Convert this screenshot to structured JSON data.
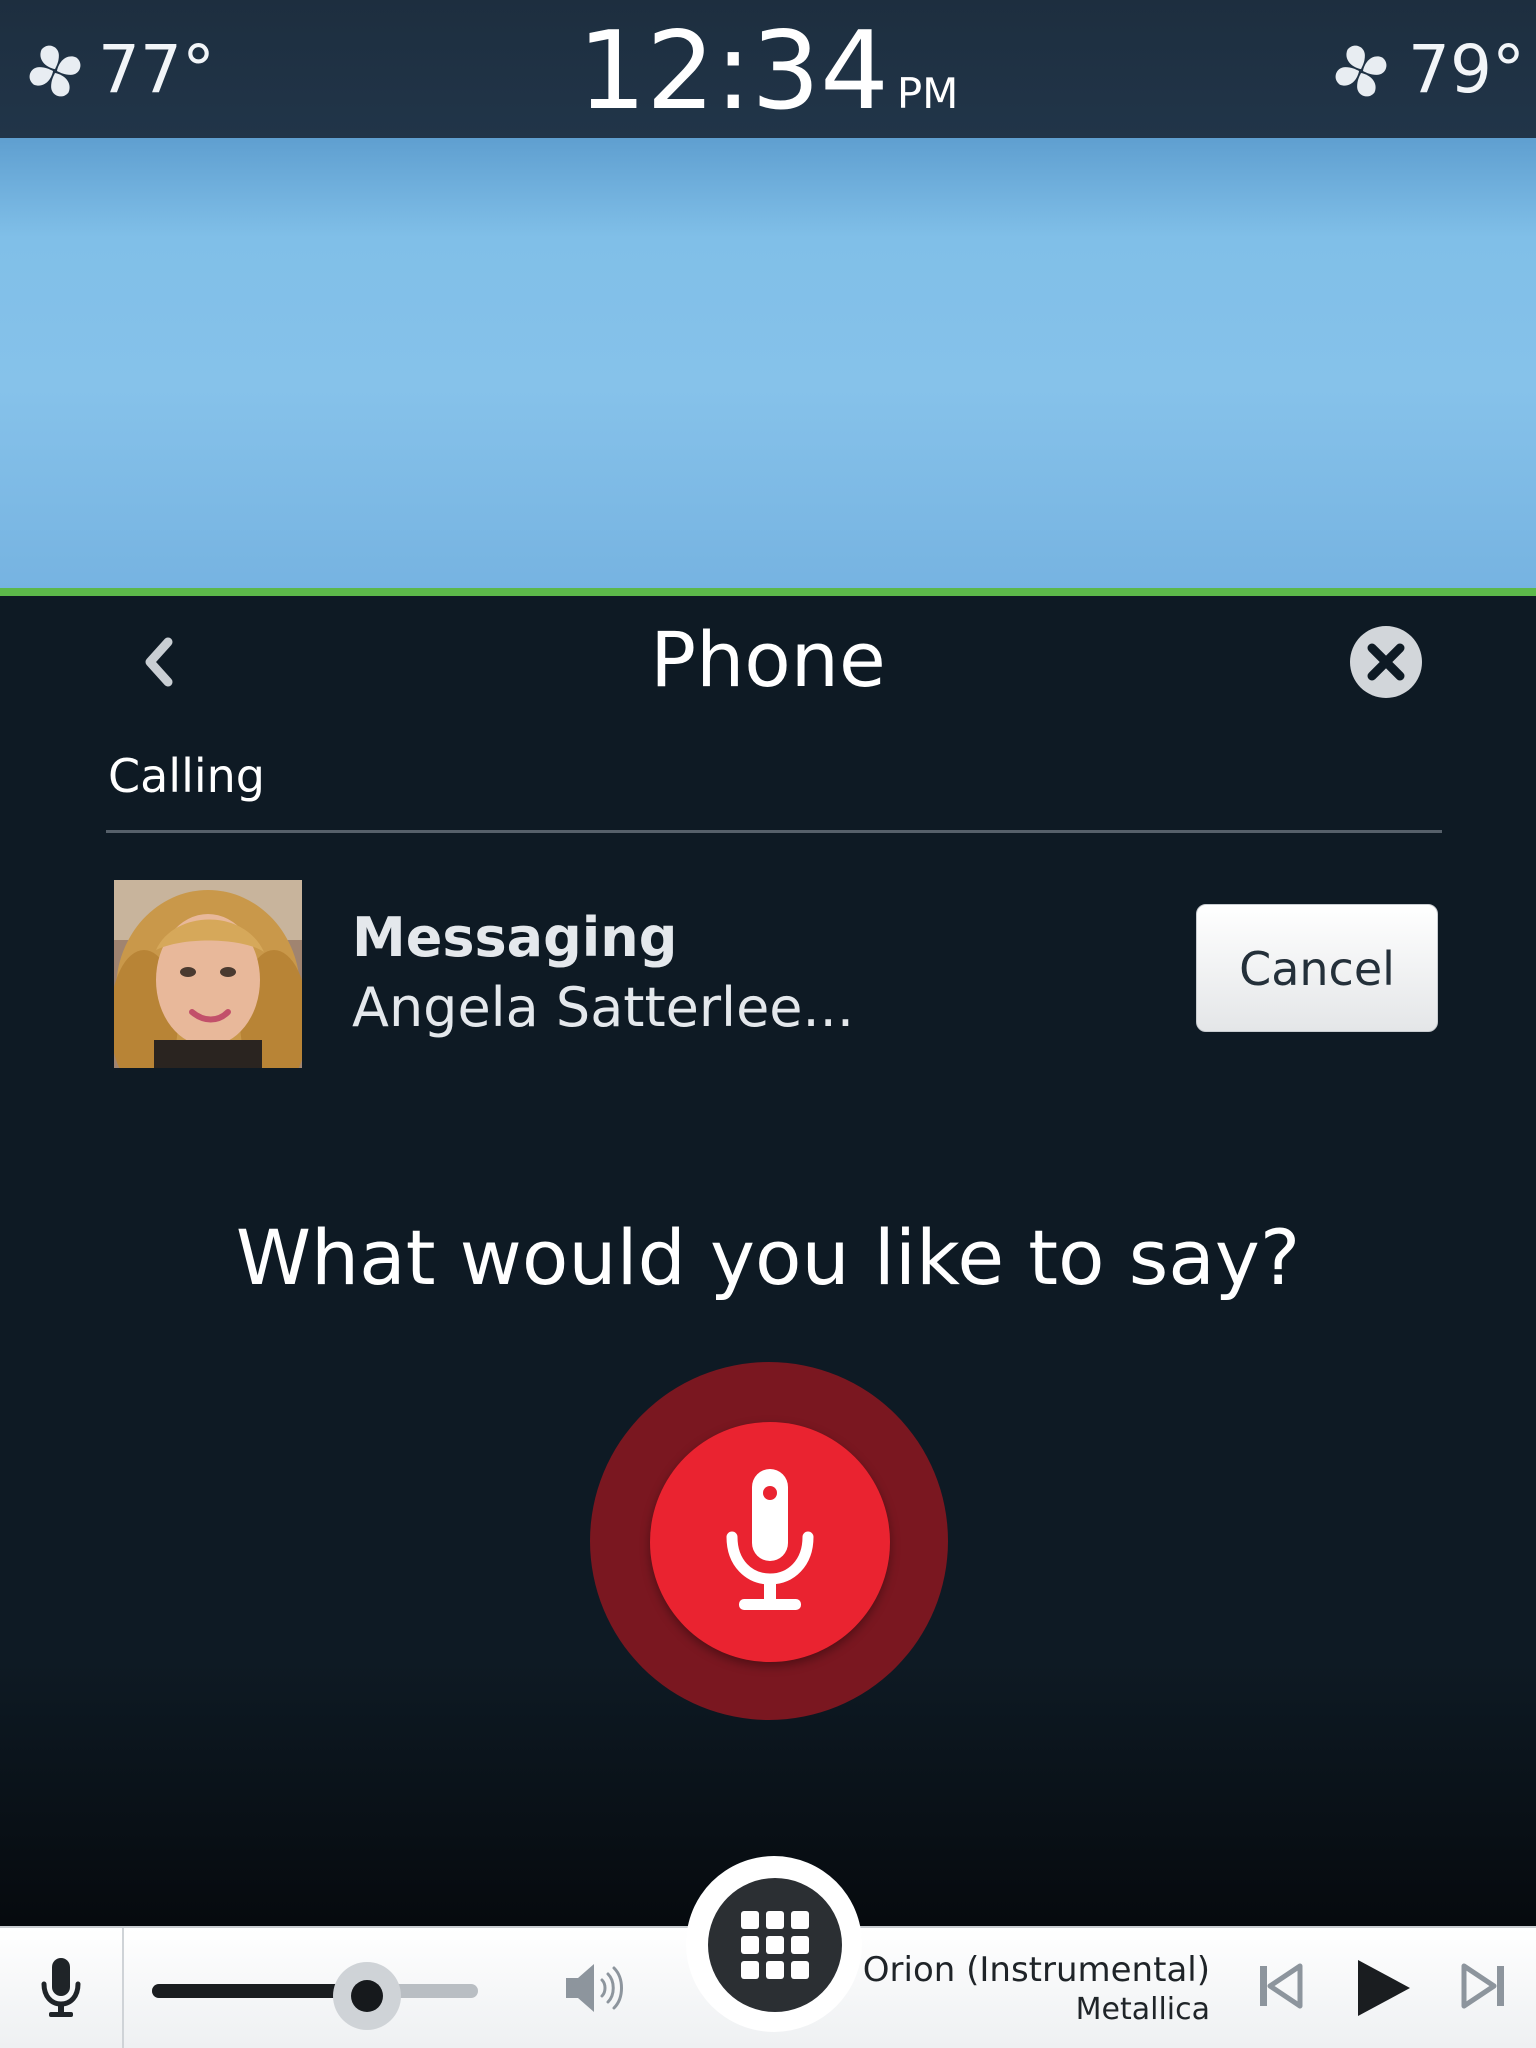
{
  "status_bar": {
    "left_temp": "77°",
    "time": "12:34",
    "ampm": "PM",
    "right_temp": "79°",
    "left_icon": "fan-icon",
    "right_icon": "fan-icon"
  },
  "phone_panel": {
    "title": "Phone",
    "back_icon": "chevron-left-icon",
    "close_icon": "close-circle-icon",
    "section_label": "Calling",
    "contact": {
      "action": "Messaging",
      "name": "Angela Satterlee...",
      "avatar": "contact-photo"
    },
    "cancel_label": "Cancel",
    "prompt": "What would you like to say?",
    "mic_icon": "microphone-icon"
  },
  "bottom_bar": {
    "mic_icon": "microphone-icon",
    "volume_level": 0.66,
    "speaker_icon": "speaker-icon",
    "home_icon": "grid-icon",
    "now_playing": {
      "title": "Orion (Instrumental)",
      "artist": "Metallica"
    },
    "controls": [
      "previous-track-icon",
      "play-icon",
      "next-track-icon"
    ]
  },
  "colors": {
    "accent_line": "#5cb84a",
    "panel_bg": "#0e1a24",
    "mic_red": "#ea2330",
    "mic_ring": "#7a1720"
  }
}
